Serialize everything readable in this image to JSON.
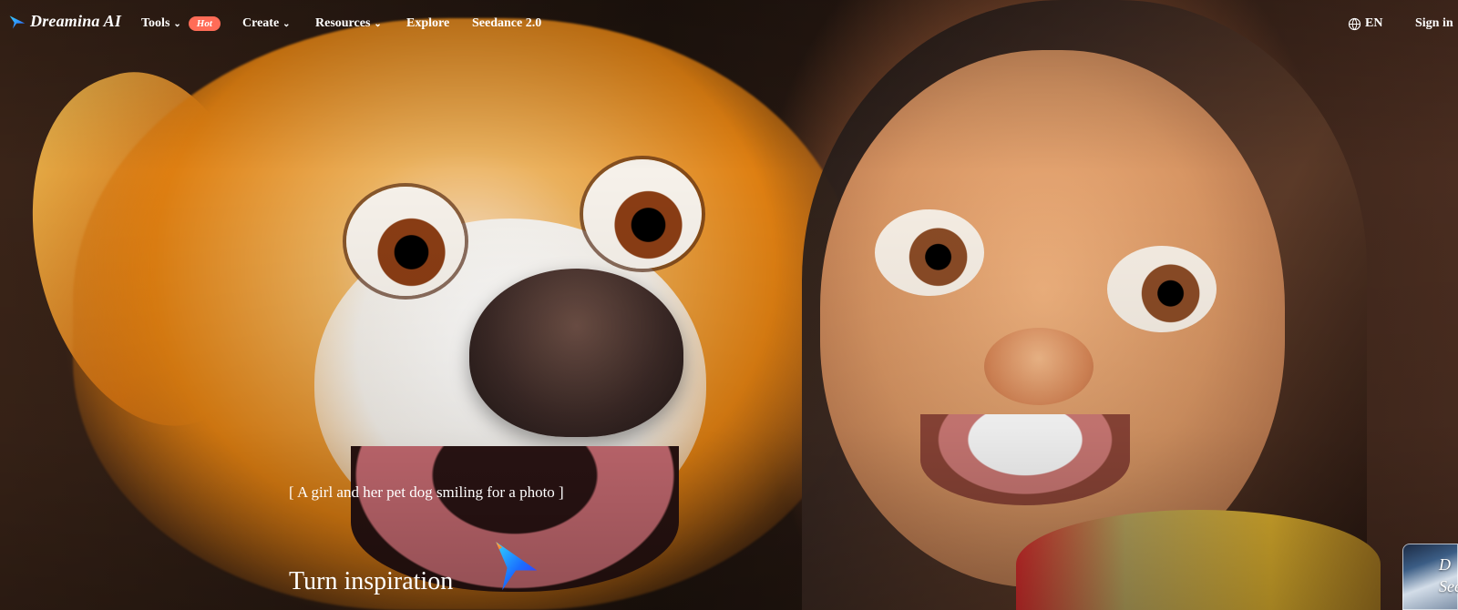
{
  "nav": {
    "brand": "Dreamina AI",
    "items": [
      {
        "label": "Tools",
        "has_chevron": true
      },
      {
        "label": "Create",
        "has_chevron": true
      },
      {
        "label": "Resources",
        "has_chevron": true
      },
      {
        "label": "Explore",
        "has_chevron": false
      },
      {
        "label": "Seedance 2.0",
        "has_chevron": false
      }
    ],
    "hot_badge": "Hot",
    "language": "EN",
    "sign_in": "Sign in"
  },
  "hero": {
    "caption": "[ A girl and her pet dog smiling for a photo ]",
    "title": "Turn inspiration"
  },
  "thumbnail": {
    "top_text": "D",
    "bottom_text": "See"
  },
  "colors": {
    "hot_badge": "#ff6c57",
    "text": "#ffffff",
    "logo_gradient_start": "#36d2ff",
    "logo_gradient_end": "#2b59ff"
  },
  "icons": {
    "logo": "dreamina-logo-icon",
    "language": "globe-icon",
    "dropdown": "chevron-down-icon",
    "hero_mark": "spark-icon"
  }
}
